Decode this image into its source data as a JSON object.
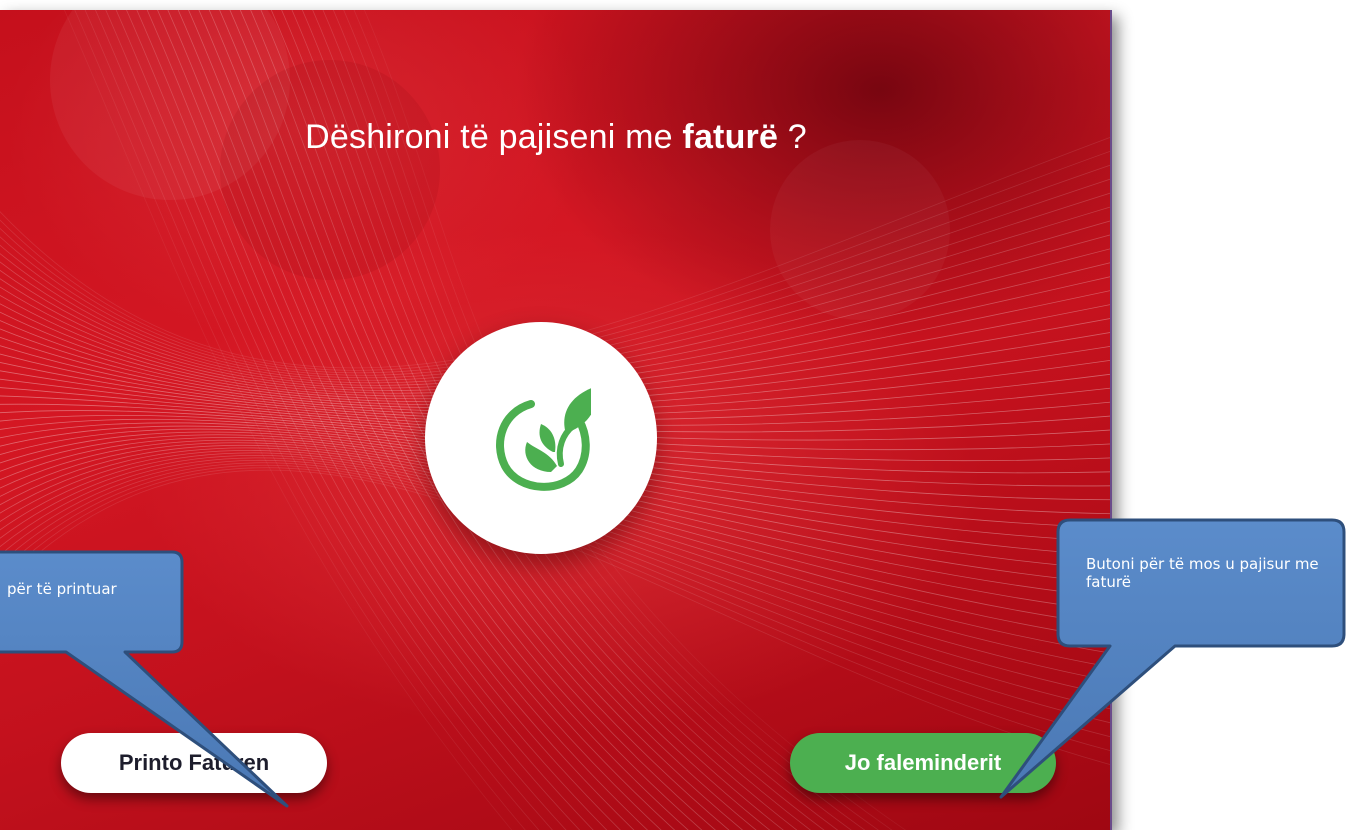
{
  "screen": {
    "title_prefix": "Dëshironi të pajiseni me ",
    "title_bold": "faturë",
    "title_suffix": " ?",
    "logo_icon": "leaf-sprout-icon",
    "colors": {
      "background_red": "#c5101c",
      "logo_green": "#4caf50",
      "no_button_green": "#4caf50",
      "print_button_white": "#ffffff"
    }
  },
  "buttons": {
    "print_label": "Printo Faturen",
    "no_label": "Jo faleminderit"
  },
  "callouts": {
    "left_text": "për të printuar",
    "right_text": "Butoni për të mos u pajisur me faturë",
    "color": "#4f81bd"
  }
}
